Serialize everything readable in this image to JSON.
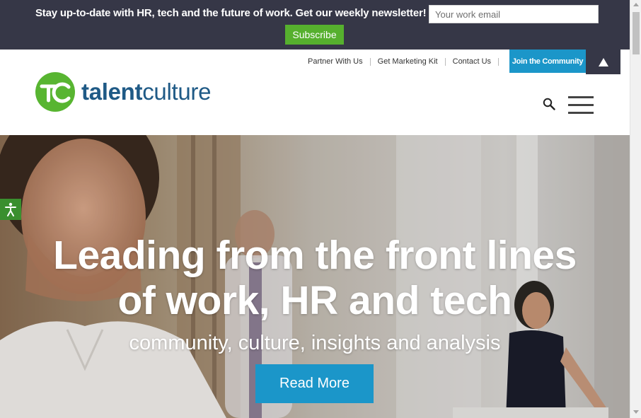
{
  "newsletter": {
    "text": "Stay up-to-date with HR, tech and the future of work. Get our weekly newsletter!",
    "email_placeholder": "Your work email",
    "subscribe_label": "Subscribe"
  },
  "top_links": [
    "Partner With Us",
    "Get Marketing Kit",
    "Contact Us"
  ],
  "join_label": "Join the Community",
  "logo": {
    "mark": "TC",
    "text_bold": "talent",
    "text_regular": "culture"
  },
  "icons": {
    "scroll_top": "triangle-up-icon",
    "search": "search-icon",
    "menu": "hamburger-menu-icon",
    "accessibility": "accessibility-icon"
  },
  "hero": {
    "title_line1": "Leading from the front lines",
    "title_line2": "of work, HR and tech",
    "subtitle": "community, culture, insights and analysis",
    "button_label": "Read More"
  },
  "colors": {
    "newsbar_bg": "#363747",
    "subscribe_green": "#56b02e",
    "accent_blue": "#1b96c9",
    "logo_green": "#58b531",
    "logo_blue": "#1f5a86"
  }
}
